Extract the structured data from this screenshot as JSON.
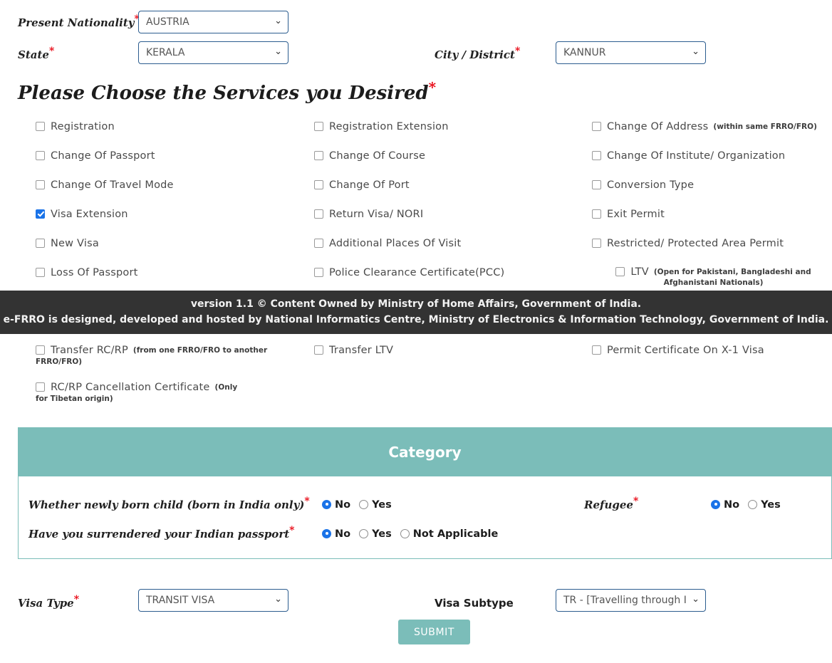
{
  "form": {
    "nationality": {
      "label": "Present Nationality",
      "required": true,
      "value": "AUSTRIA"
    },
    "state": {
      "label": "State",
      "required": true,
      "value": "KERALA"
    },
    "city": {
      "label": "City / District",
      "required": true,
      "value": "KANNUR"
    },
    "visa_type": {
      "label": "Visa Type",
      "required": true,
      "value": "TRANSIT VISA"
    },
    "visa_subtype": {
      "label": "Visa Subtype",
      "required": false,
      "value": "TR - [Travelling through In"
    }
  },
  "services": {
    "heading": "Please Choose the Services you Desired",
    "heading_required": true,
    "column1": [
      {
        "label": "Registration",
        "note": "",
        "checked": false
      },
      {
        "label": "Change Of Passport",
        "note": "",
        "checked": false
      },
      {
        "label": "Change Of Travel Mode",
        "note": "",
        "checked": false
      },
      {
        "label": "Visa Extension",
        "note": "",
        "checked": true
      },
      {
        "label": "New Visa",
        "note": "",
        "checked": false
      },
      {
        "label": "Loss Of Passport",
        "note": "",
        "checked": false
      }
    ],
    "column2": [
      {
        "label": "Registration Extension",
        "note": "",
        "checked": false
      },
      {
        "label": "Change Of Course",
        "note": "",
        "checked": false
      },
      {
        "label": "Change Of Port",
        "note": "",
        "checked": false
      },
      {
        "label": "Return Visa/ NORI",
        "note": "",
        "checked": false
      },
      {
        "label": "Additional Places Of Visit",
        "note": "",
        "checked": false
      },
      {
        "label": "Police Clearance Certificate(PCC)",
        "note": "",
        "checked": false
      }
    ],
    "column3": [
      {
        "label": "Change Of Address",
        "note": "(within same FRRO/FRO)",
        "checked": false
      },
      {
        "label": "Change Of Institute/ Organization",
        "note": "",
        "checked": false
      },
      {
        "label": "Conversion Type",
        "note": "",
        "checked": false
      },
      {
        "label": "Exit Permit",
        "note": "",
        "checked": false
      },
      {
        "label": "Restricted/ Protected Area Permit",
        "note": "",
        "checked": false
      },
      {
        "label": "LTV",
        "note": "(Open for Pakistani, Bangladeshi and Afghanistani Nationals)",
        "checked": false
      }
    ],
    "below_band": {
      "transfer_rcrp": {
        "label": "Transfer RC/RP",
        "note": "(from one FRRO/FRO to another FRRO/FRO)",
        "checked": false
      },
      "rcrp_cancellation": {
        "label": "RC/RP Cancellation Certificate",
        "note": "(Only for Tibetan origin)",
        "checked": false
      },
      "transfer_ltv": {
        "label": "Transfer LTV",
        "note": "",
        "checked": false
      },
      "permit_x1": {
        "label": "Permit Certificate On X-1 Visa",
        "note": "",
        "checked": false
      }
    }
  },
  "footer_band": {
    "line1": "version 1.1 © Content Owned by Ministry of Home Affairs, Government of India.",
    "line2": "e-FRRO is designed, developed and hosted by National Informatics Centre, Ministry of Electronics & Information Technology, Government of India."
  },
  "category": {
    "title": "Category",
    "newborn": {
      "label": "Whether newly born child   (born in India only)",
      "required": true,
      "options": [
        "No",
        "Yes"
      ],
      "selected": "No"
    },
    "surrendered": {
      "label": "Have you surrendered your Indian passport",
      "required": true,
      "options": [
        "No",
        "Yes",
        "Not Applicable"
      ],
      "selected": "No"
    },
    "refugee": {
      "label": "Refugee",
      "required": true,
      "options": [
        "No",
        "Yes"
      ],
      "selected": "No"
    }
  },
  "actions": {
    "submit_label": "SUBMIT"
  },
  "icons": {
    "chevron": "⌄"
  },
  "colors": {
    "teal": "#7bbdb9",
    "accent_blue": "#1a73e8",
    "required_red": "#e8000d",
    "band_dark": "#333333"
  }
}
